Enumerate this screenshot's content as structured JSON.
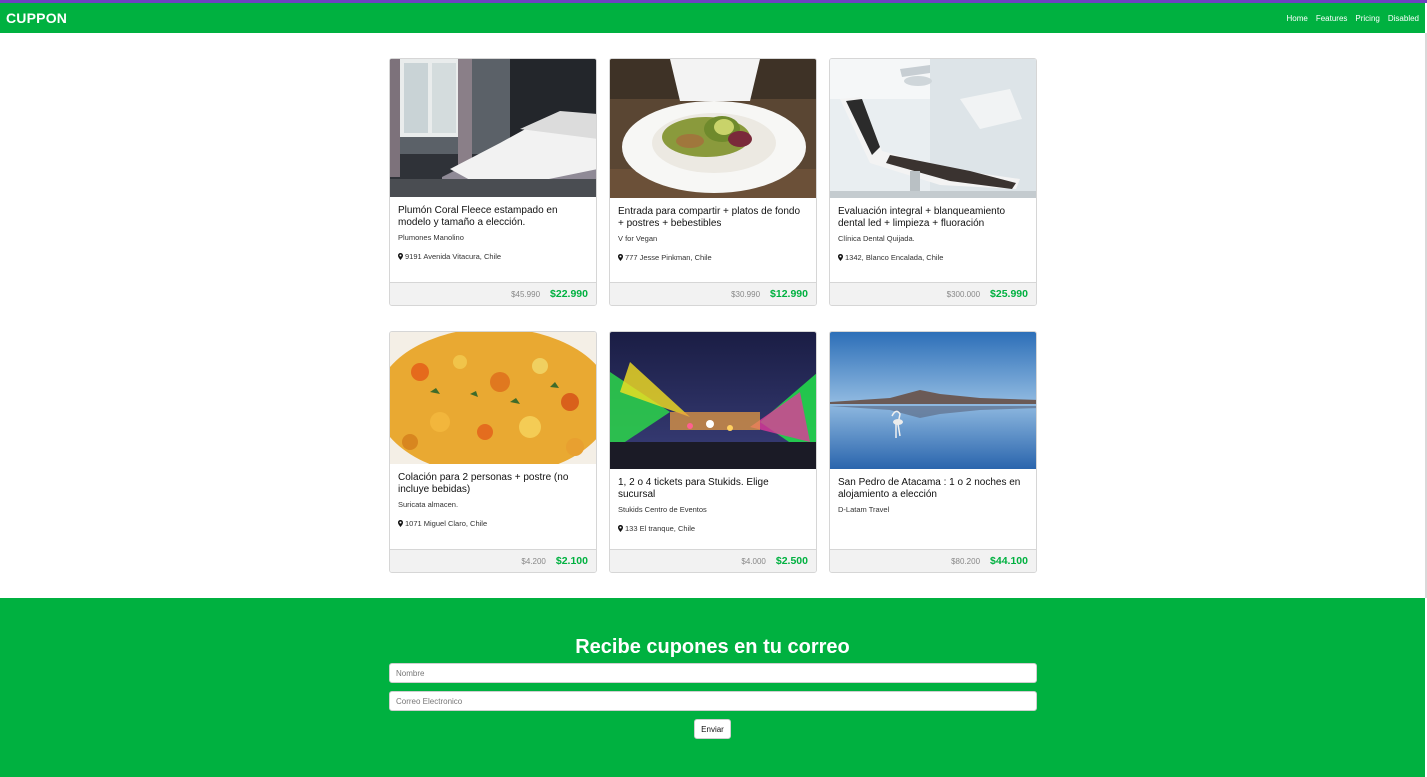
{
  "header": {
    "brand": "CUPPON",
    "nav": [
      {
        "label": "Home"
      },
      {
        "label": "Features"
      },
      {
        "label": "Pricing"
      },
      {
        "label": "Disabled"
      }
    ]
  },
  "colors": {
    "brand_green": "#00b140",
    "top_accent": "#6f42c1"
  },
  "deals": [
    {
      "image": "bedroom-photo",
      "title": "Plumón Coral Fleece estampado en modelo y tamaño a elección.",
      "merchant": "Plumones Manolino",
      "location": "9191 Avenida Vitacura, Chile",
      "old_price": "$45.990",
      "price": "$22.990"
    },
    {
      "image": "food-plate-photo",
      "title": "Entrada para compartir + platos de fondo + postres + bebestibles",
      "merchant": "V for Vegan",
      "location": "777 Jesse Pinkman, Chile",
      "old_price": "$30.990",
      "price": "$12.990"
    },
    {
      "image": "dental-chair-photo",
      "title": "Evaluación integral + blanqueamiento dental led + limpieza + fluoración",
      "merchant": "Clínica Dental Quijada.",
      "location": "1342, Blanco Encalada, Chile",
      "old_price": "$300.000",
      "price": "$25.990"
    },
    {
      "image": "stew-photo",
      "title": "Colación para 2 personas + postre (no incluye bebidas)",
      "merchant": "Suricata almacen.",
      "location": "1071 Miguel Claro, Chile",
      "old_price": "$4.200",
      "price": "$2.100"
    },
    {
      "image": "amusement-park-photo",
      "title": "1, 2 o 4 tickets para Stukids. Elige sucursal",
      "merchant": "Stukids Centro de Eventos",
      "location": "133 El tranque, Chile",
      "old_price": "$4.000",
      "price": "$2.500"
    },
    {
      "image": "salt-lake-flamingo-photo",
      "title": "San Pedro de Atacama : 1 o 2 noches en alojamiento a elección",
      "merchant": "D-Latam Travel",
      "location": "",
      "old_price": "$80.200",
      "price": "$44.100"
    }
  ],
  "newsletter": {
    "title": "Recibe cupones en tu correo",
    "name_placeholder": "Nombre",
    "email_placeholder": "Correo Electronico",
    "submit_label": "Enviar"
  }
}
